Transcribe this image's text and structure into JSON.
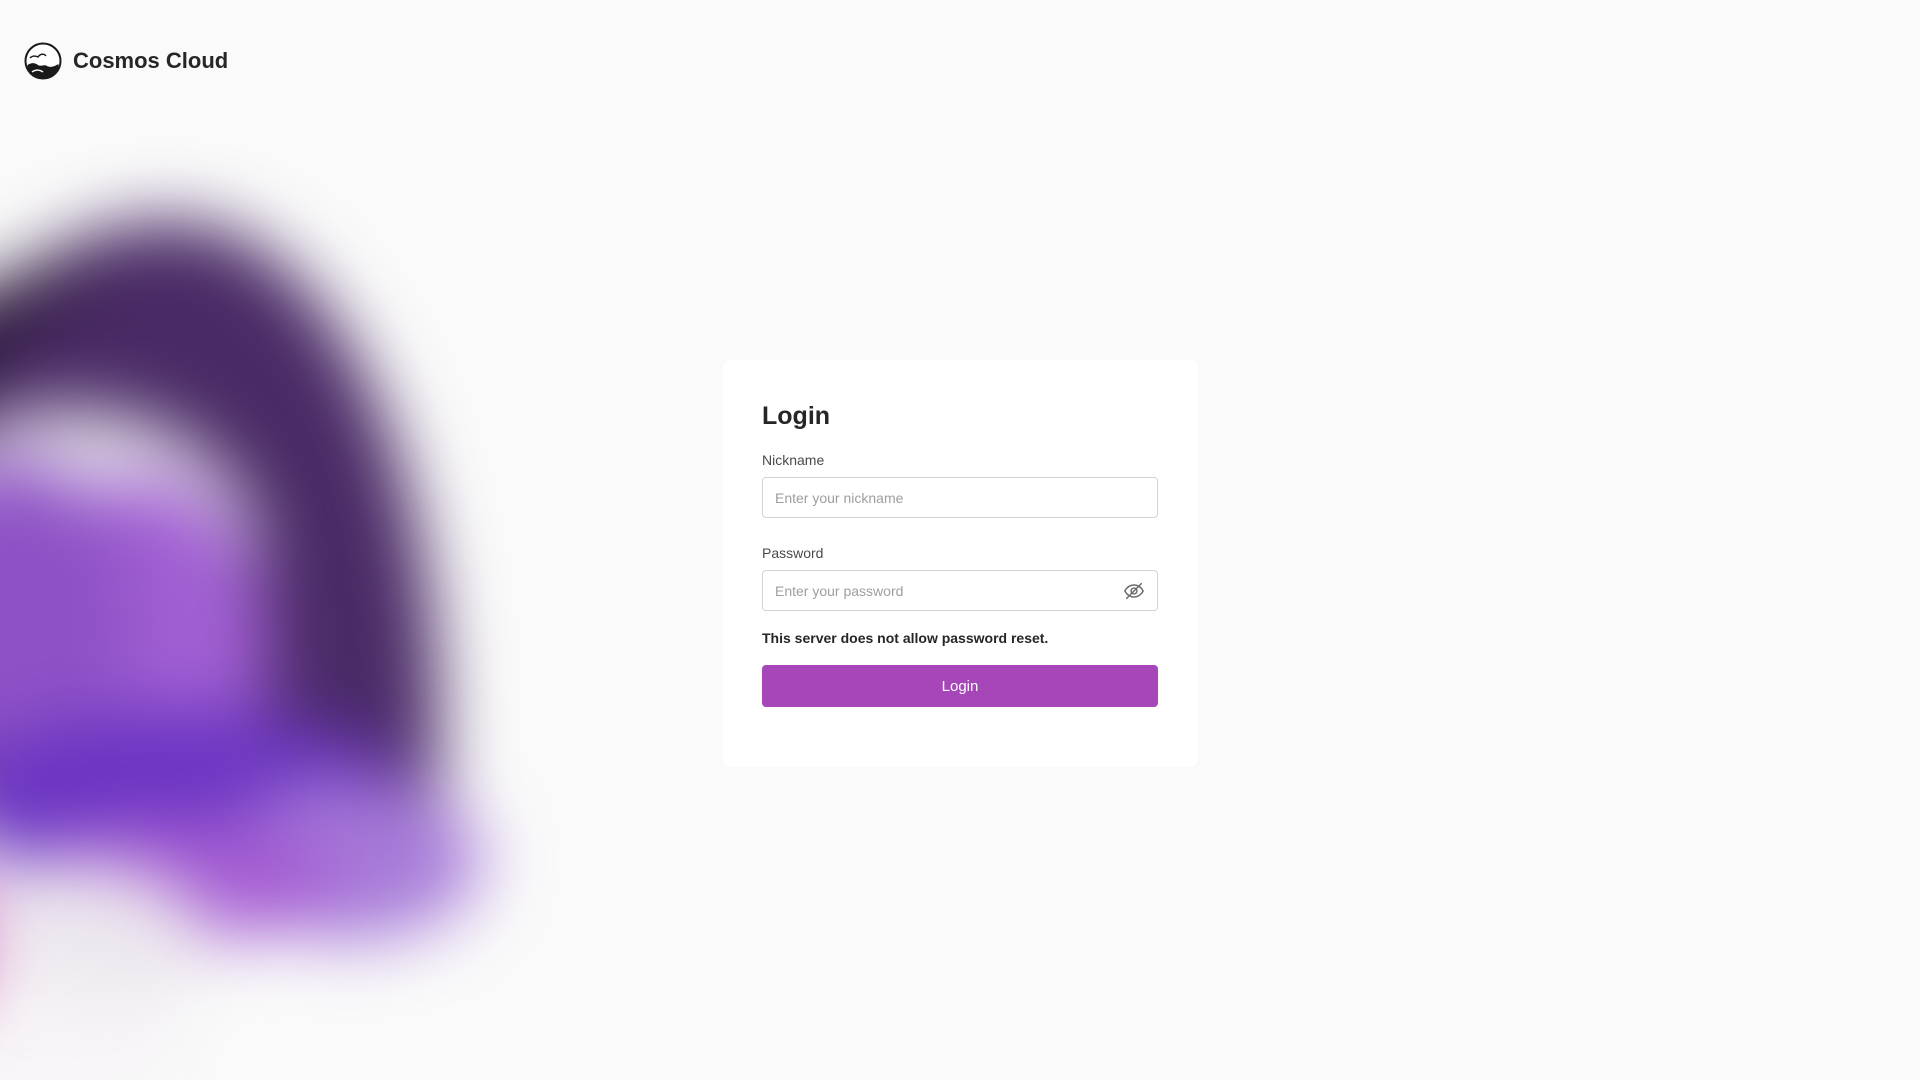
{
  "app": {
    "brand_name": "Cosmos Cloud",
    "logo_icon": "cosmos-cloud-logo-icon"
  },
  "login": {
    "title": "Login",
    "nickname": {
      "label": "Nickname",
      "placeholder": "Enter your nickname",
      "value": ""
    },
    "password": {
      "label": "Password",
      "placeholder": "Enter your password",
      "value": "",
      "toggle_icon": "eye-off-icon"
    },
    "notice": "This server does not allow password reset.",
    "submit_label": "Login"
  },
  "colors": {
    "accent": "#a646b8",
    "background": "#fafafa",
    "card": "#ffffff"
  }
}
